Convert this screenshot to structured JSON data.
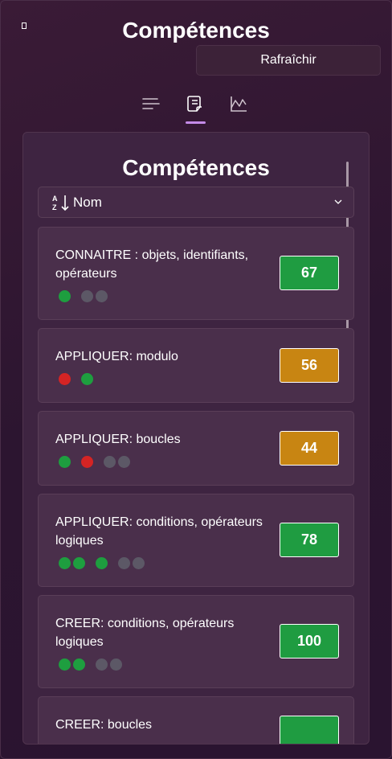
{
  "window": {
    "title": "Compétences"
  },
  "toolbar": {
    "refresh_label": "Rafraîchir"
  },
  "tabs": [
    {
      "name": "list-tab",
      "icon": "lines-icon"
    },
    {
      "name": "document-tab",
      "icon": "document-icon",
      "selected": true
    },
    {
      "name": "chart-tab",
      "icon": "chart-icon"
    }
  ],
  "panel": {
    "title": "Compétences",
    "sort": {
      "icon": "sort-az-icon",
      "label": "Nom"
    }
  },
  "skills": [
    {
      "name": "CONNAITRE : objets, identifiants, opérateurs",
      "score": "67",
      "score_color": "#1f9c41",
      "dots": [
        "green",
        "gap",
        "gray",
        "gray"
      ]
    },
    {
      "name": "APPLIQUER: modulo",
      "score": "56",
      "score_color": "#c88512",
      "dots": [
        "red",
        "gap",
        "green"
      ]
    },
    {
      "name": "APPLIQUER: boucles",
      "score": "44",
      "score_color": "#c88512",
      "dots": [
        "green",
        "gap",
        "red",
        "gap",
        "gray",
        "gray"
      ]
    },
    {
      "name": "APPLIQUER: conditions, opérateurs logiques",
      "score": "78",
      "score_color": "#1f9c41",
      "dots": [
        "green",
        "green",
        "gap",
        "green",
        "gap",
        "gray",
        "gray"
      ]
    },
    {
      "name": "CREER: conditions, opérateurs logiques",
      "score": "100",
      "score_color": "#1f9c41",
      "dots": [
        "green",
        "green",
        "gap",
        "gray",
        "gray"
      ]
    },
    {
      "name": "CREER: boucles",
      "score": "",
      "score_color": "#1f9c41",
      "dots": []
    }
  ]
}
